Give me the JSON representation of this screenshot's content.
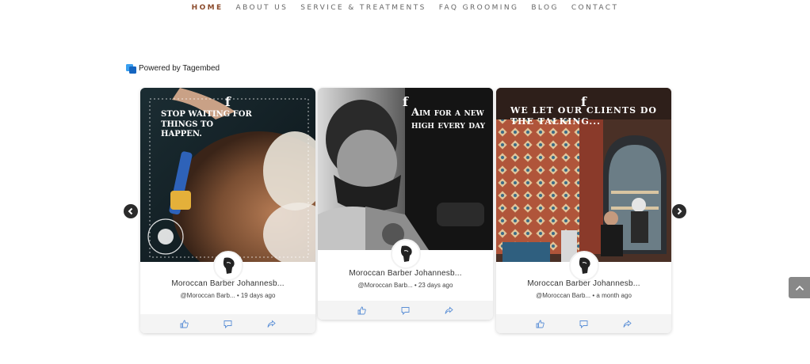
{
  "nav": {
    "items": [
      "HOME",
      "ABOUT US",
      "SERVICE & TREATMENTS",
      "FAQ GROOMING",
      "BLOG",
      "CONTACT"
    ]
  },
  "powered": {
    "label": "Powered by Tagembed"
  },
  "cards": [
    {
      "quote": "Stop waiting for things to happen.",
      "author": "Moroccan Barber Johannesb...",
      "handle": "@Moroccan Barb...",
      "time": "• 19 days ago"
    },
    {
      "quote": "Aim for a new high every day",
      "author": "Moroccan Barber Johannesb...",
      "handle": "@Moroccan Barb...",
      "time": "• 23 days ago"
    },
    {
      "quote": "We let our clients do the talking...",
      "author": "Moroccan Barber Johannesb...",
      "handle": "@Moroccan Barb...",
      "time": "• a month ago"
    }
  ],
  "icons": {
    "social": "facebook-icon",
    "like": "thumbs-up-icon",
    "comment": "comment-icon",
    "share": "share-icon"
  },
  "colors": {
    "nav_active": "#8b4a2b",
    "nav_text": "#666666",
    "action_icon": "#5b8fd6",
    "arrow_bg": "#2b2b2b"
  }
}
